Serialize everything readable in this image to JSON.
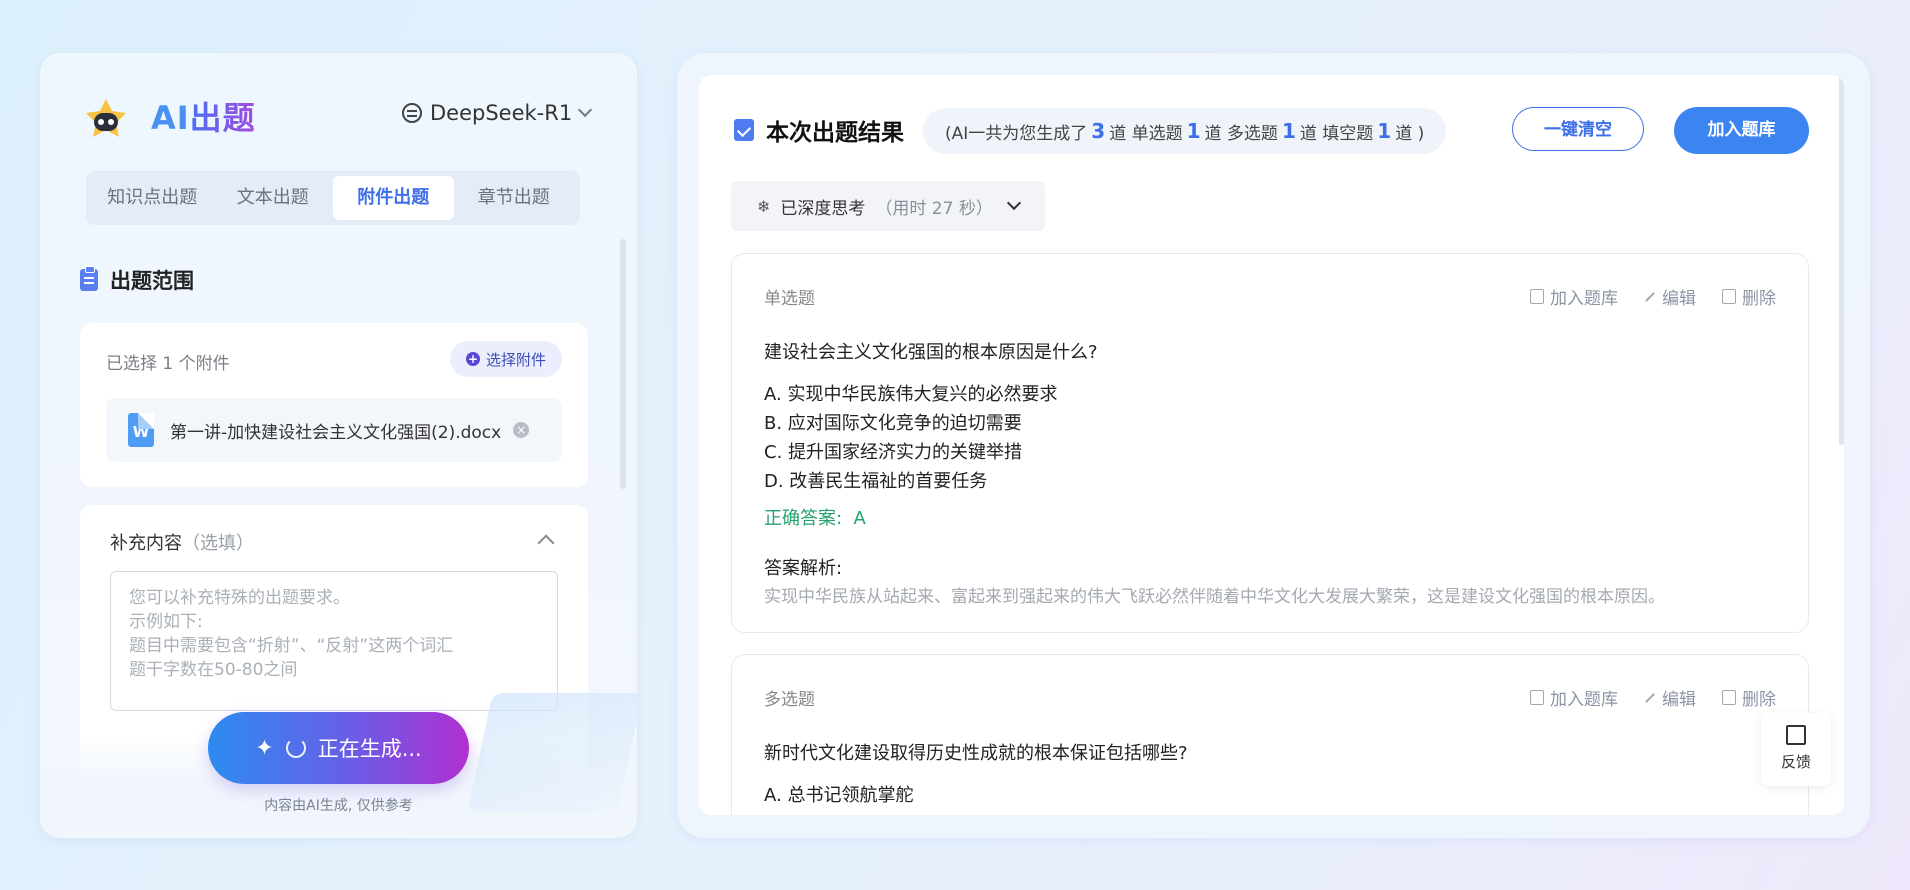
{
  "app": {
    "brand_ai": "AI",
    "brand_rest": "出题",
    "model": "DeepSeek-R1"
  },
  "tabs": [
    {
      "label": "知识点出题",
      "active": false
    },
    {
      "label": "文本出题",
      "active": false
    },
    {
      "label": "附件出题",
      "active": true
    },
    {
      "label": "章节出题",
      "active": false
    }
  ],
  "scope": {
    "title": "出题范围",
    "selected_text": "已选择 1 个附件",
    "select_button": "选择附件",
    "file_icon_letter": "W",
    "file_name": "第一讲-加快建设社会主义文化强国(2).docx"
  },
  "supplement": {
    "title": "补充内容",
    "optional": "（选填）",
    "placeholder_lines": [
      "您可以补充特殊的出题要求。",
      "示例如下:",
      "题目中需要包含“折射”、“反射”这两个词汇",
      "题干字数在50-80之间"
    ]
  },
  "generate": {
    "label": "正在生成...",
    "note": "内容由AI生成, 仅供参考"
  },
  "result": {
    "title": "本次出题结果",
    "summary": {
      "p1": "(AI一共为您生成了",
      "total": "3",
      "p2": "道 单选题",
      "single": "1",
      "p3": "道 多选题",
      "multi": "1",
      "p4": "道 填空题",
      "fill": "1",
      "p5": "道 )"
    },
    "clear_button": "一键清空",
    "add_button": "加入题库",
    "thinking": {
      "label": "已深度思考",
      "duration": "（用时 27 秒）"
    }
  },
  "question_actions": {
    "add": "加入题库",
    "edit": "编辑",
    "delete": "删除"
  },
  "questions": [
    {
      "type": "单选题",
      "stem": "建设社会主义文化强国的根本原因是什么?",
      "options": [
        "A.  实现中华民族伟大复兴的必然要求",
        "B.  应对国际文化竞争的迫切需要",
        "C.  提升国家经济实力的关键举措",
        "D.  改善民生福祉的首要任务"
      ],
      "answer_label": "正确答案:",
      "answer": "A",
      "analysis_label": "答案解析:",
      "analysis": "实现中华民族从站起来、富起来到强起来的伟大飞跃必然伴随着中华文化大发展大繁荣，这是建设文化强国的根本原因。"
    },
    {
      "type": "多选题",
      "stem": "新时代文化建设取得历史性成就的根本保证包括哪些?",
      "options": [
        "A.  总书记领航掌舵"
      ]
    }
  ],
  "feedback": "反馈"
}
